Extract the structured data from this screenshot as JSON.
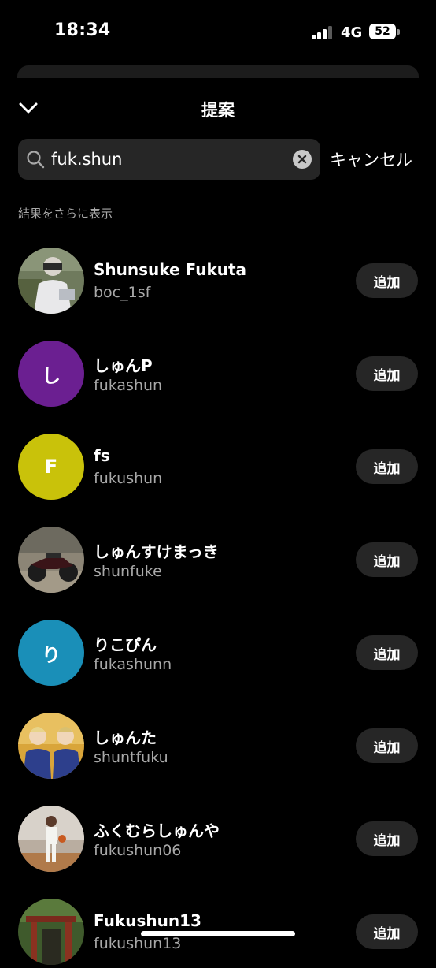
{
  "status_bar": {
    "time": "18:34",
    "network": "4G",
    "battery": "52",
    "signal_icon": "cellular-signal-icon",
    "battery_icon": "battery-icon"
  },
  "header": {
    "title": "提案",
    "collapse_icon": "chevron-down-icon"
  },
  "search": {
    "query": "fuk.shun",
    "icon": "search-icon",
    "clear_icon": "clear-circle-icon",
    "cancel_label": "キャンセル"
  },
  "more_results_label": "結果をさらに表示",
  "results": [
    {
      "name": "Shunsuke Fukuta",
      "handle": "boc_1sf",
      "avatar_type": "photo-person",
      "add_label": "追加"
    },
    {
      "name": "しゅんP",
      "handle": "fukashun",
      "avatar_type": "initial",
      "initial": "し",
      "avatar_color": "#6b1f91",
      "add_label": "追加"
    },
    {
      "name": "fs",
      "handle": "fukushun",
      "avatar_type": "initial",
      "initial": "F",
      "avatar_color": "#c9c20a",
      "add_label": "追加"
    },
    {
      "name": "しゅんすけまっき",
      "handle": "shunfuke",
      "avatar_type": "photo-motorcycle",
      "add_label": "追加"
    },
    {
      "name": "りこぴん",
      "handle": "fukashunn",
      "avatar_type": "initial",
      "initial": "り",
      "avatar_color": "#1a8fb8",
      "add_label": "追加"
    },
    {
      "name": "しゅんた",
      "handle": "shuntfuku",
      "avatar_type": "photo-duo",
      "add_label": "追加"
    },
    {
      "name": "ふくむらしゅんや",
      "handle": "fukushun06",
      "avatar_type": "photo-basketball",
      "add_label": "追加"
    },
    {
      "name": "Fukushun13",
      "handle": "fukushun13",
      "avatar_type": "photo-shrine",
      "add_label": "追加"
    }
  ],
  "colors": {
    "background": "#000000",
    "surface": "#262626",
    "secondary_text": "#a8a8a8"
  }
}
